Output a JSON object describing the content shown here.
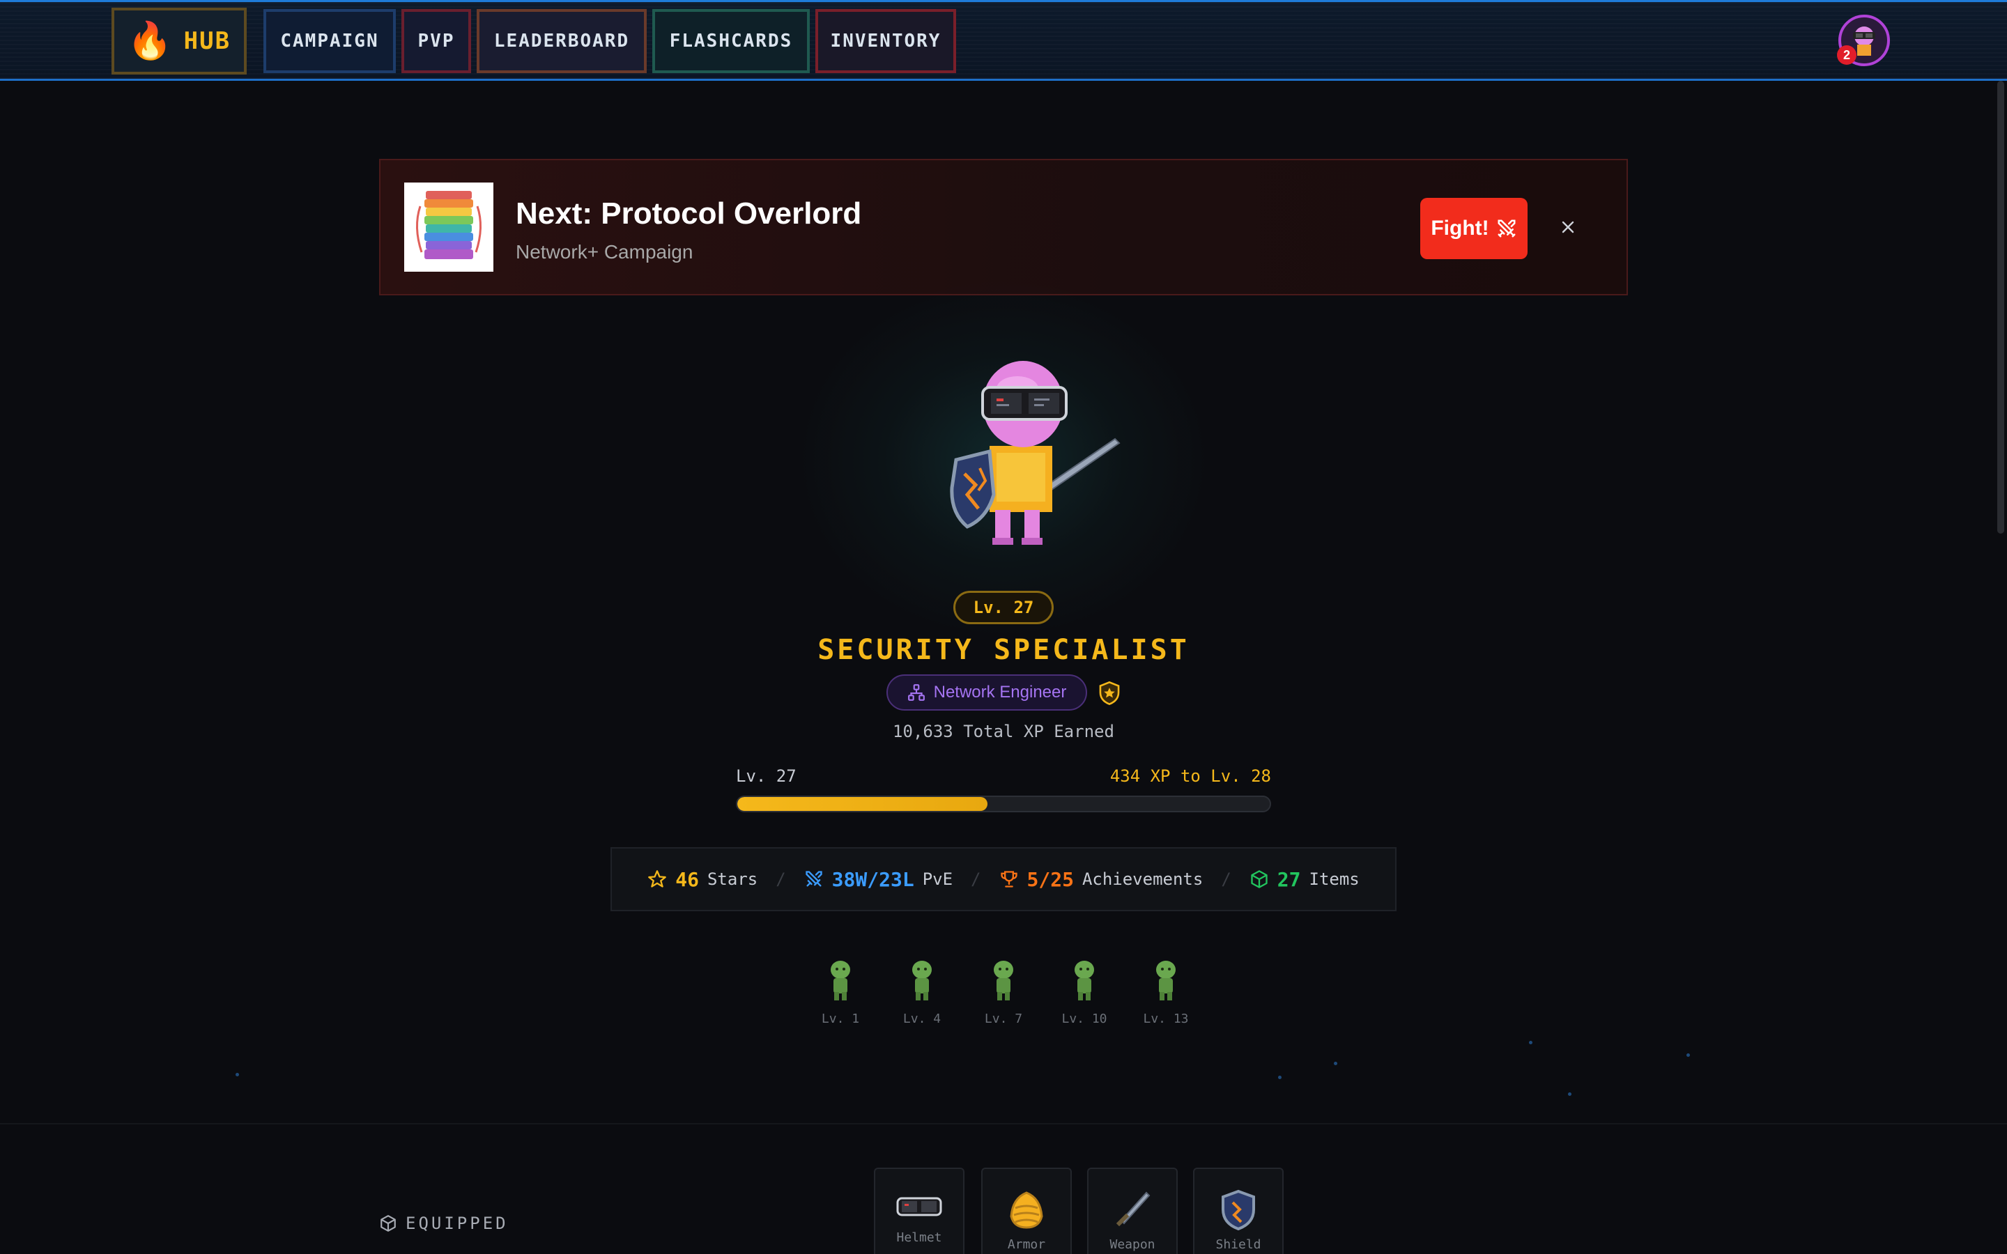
{
  "nav": {
    "hub_label": "HUB",
    "items": [
      {
        "label": "CAMPAIGN"
      },
      {
        "label": "PVP"
      },
      {
        "label": "LEADERBOARD"
      },
      {
        "label": "FLASHCARDS"
      },
      {
        "label": "INVENTORY"
      }
    ],
    "notification_count": "2"
  },
  "banner": {
    "title": "Next: Protocol Overlord",
    "subtitle": "Network+ Campaign",
    "fight_label": "Fight!"
  },
  "hero": {
    "level_badge": "Lv. 27",
    "title": "SECURITY SPECIALIST",
    "class_name": "Network Engineer",
    "total_xp": "10,633 Total XP Earned",
    "xp_level_label": "Lv. 27",
    "xp_next_label": "434 XP to Lv. 28",
    "xp_progress": 0.47
  },
  "stats": {
    "stars_value": "46",
    "stars_label": "Stars",
    "pve_value": "38W/23L",
    "pve_label": "PvE",
    "ach_value": "5/25",
    "ach_label": "Achievements",
    "items_value": "27",
    "items_label": "Items"
  },
  "evolution": [
    {
      "label": "Lv. 1"
    },
    {
      "label": "Lv. 4"
    },
    {
      "label": "Lv. 7"
    },
    {
      "label": "Lv. 10"
    },
    {
      "label": "Lv. 13"
    }
  ],
  "equipped": {
    "label": "EQUIPPED",
    "slots": [
      {
        "label": "Helmet"
      },
      {
        "label": "Armor"
      },
      {
        "label": "Weapon"
      },
      {
        "label": "Shield"
      }
    ]
  },
  "colors": {
    "accent_gold": "#f5b81b",
    "fight_red": "#f22c1c",
    "class_purple": "#a574f2",
    "pve_blue": "#3b9cff",
    "ach_orange": "#f97316",
    "items_green": "#22c55e"
  }
}
